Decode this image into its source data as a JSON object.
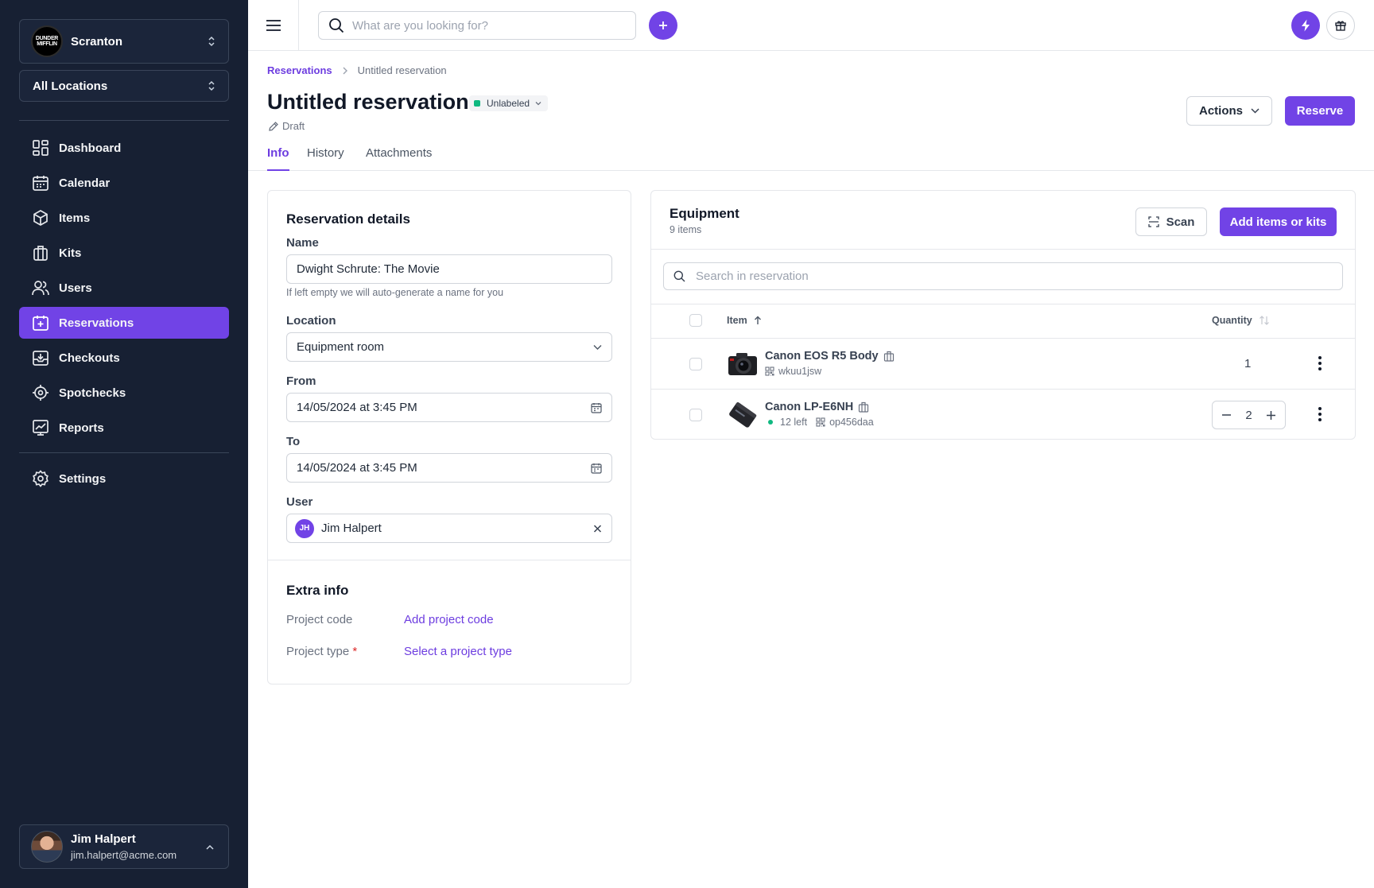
{
  "sidebar": {
    "organization": "Scranton",
    "org_logo_text": "DUNDER MIFFLIN",
    "location_filter": "All Locations",
    "nav": [
      {
        "label": "Dashboard",
        "icon": "dashboard-icon"
      },
      {
        "label": "Calendar",
        "icon": "calendar-icon"
      },
      {
        "label": "Items",
        "icon": "cube-icon"
      },
      {
        "label": "Kits",
        "icon": "briefcase-icon"
      },
      {
        "label": "Users",
        "icon": "users-icon"
      },
      {
        "label": "Reservations",
        "icon": "calendar-plus-icon",
        "active": true
      },
      {
        "label": "Checkouts",
        "icon": "inbox-arrow-icon"
      },
      {
        "label": "Spotchecks",
        "icon": "target-icon"
      },
      {
        "label": "Reports",
        "icon": "chart-icon"
      }
    ],
    "settings_label": "Settings",
    "user": {
      "name": "Jim Halpert",
      "email": "jim.halpert@acme.com"
    }
  },
  "topbar": {
    "search_placeholder": "What are you looking for?"
  },
  "breadcrumb": {
    "parent": "Reservations",
    "current": "Untitled reservation"
  },
  "header": {
    "title": "Untitled reservation",
    "label": "Unlabeled",
    "status": "Draft",
    "actions_label": "Actions",
    "reserve_label": "Reserve"
  },
  "tabs": [
    "Info",
    "History",
    "Attachments"
  ],
  "details": {
    "title": "Reservation details",
    "name_label": "Name",
    "name_value": "Dwight Schrute: The Movie",
    "name_hint": "If left empty we will auto-generate a name for you",
    "location_label": "Location",
    "location_value": "Equipment room",
    "from_label": "From",
    "from_value": "14/05/2024 at 3:45 PM",
    "to_label": "To",
    "to_value": "14/05/2024 at 3:45 PM",
    "user_label": "User",
    "user_initials": "JH",
    "user_value": "Jim Halpert"
  },
  "extra": {
    "title": "Extra info",
    "project_code_label": "Project code",
    "project_code_link": "Add project code",
    "project_type_label": "Project type",
    "project_type_required": "*",
    "project_type_link": "Select a project type"
  },
  "equipment": {
    "title": "Equipment",
    "count": "9 items",
    "scan_label": "Scan",
    "add_label": "Add items or kits",
    "search_placeholder": "Search in reservation",
    "col_item": "Item",
    "col_quantity": "Quantity",
    "rows": [
      {
        "name": "Canon EOS R5 Body",
        "code": "wkuu1jsw",
        "quantity": "1"
      },
      {
        "name": "Canon LP-E6NH",
        "stock": "12 left",
        "code": "op456daa",
        "quantity": "2"
      }
    ]
  },
  "colors": {
    "accent": "#7143e6",
    "sidebar": "#172033",
    "label_green": "#10b981"
  }
}
